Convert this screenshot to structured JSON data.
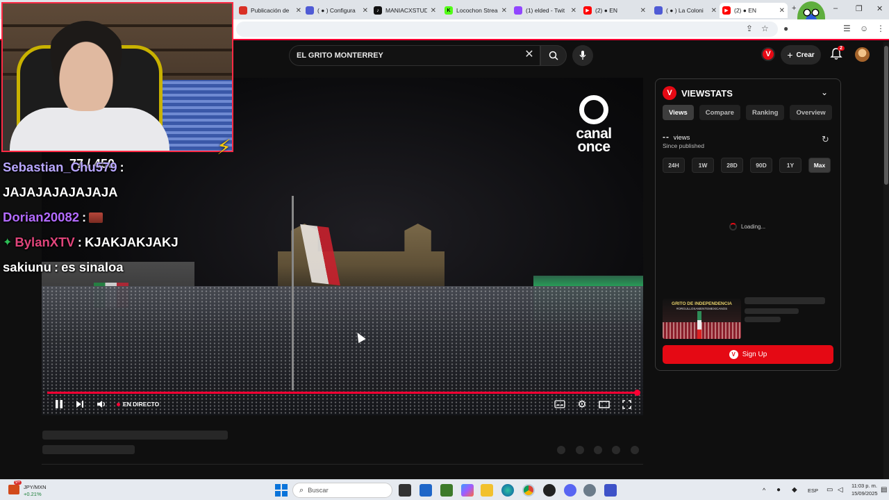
{
  "browser": {
    "tabs": [
      {
        "title": "Publicación de",
        "favicon_color": "#d93025",
        "icon": "page-icon"
      },
      {
        "title": "( ● ) Configura",
        "favicon_color": "#4f5bd5",
        "icon": "studio-icon"
      },
      {
        "title": "MANIACXSTUD",
        "favicon_color": "#111111",
        "icon": "tiktok-icon"
      },
      {
        "title": "Locochon Strea",
        "favicon_color": "#53fc18",
        "icon": "kick-icon"
      },
      {
        "title": "(1) elded - Twit",
        "favicon_color": "#9146ff",
        "icon": "twitch-icon"
      },
      {
        "title": "(2) ● EN",
        "favicon_color": "#ff0000",
        "icon": "youtube-icon"
      },
      {
        "title": "( ● ) La Coloni",
        "favicon_color": "#4f5bd5",
        "icon": "studio-icon"
      },
      {
        "title": "(2) ● EN",
        "favicon_color": "#ff0000",
        "icon": "youtube-icon"
      }
    ],
    "new_tab": "+",
    "window_controls": [
      "–",
      "❐",
      "✕"
    ]
  },
  "youtube": {
    "search_value": "EL GRITO MONTERREY",
    "create_label": "Crear",
    "notification_count": "2",
    "live_label": "EN DIRECTO"
  },
  "video": {
    "channel_logo_text": "canal\nonce"
  },
  "stream_overlay": {
    "counter": "77 / 450",
    "chat": [
      {
        "user": "Sebastian_Chu579",
        "user_color": "#b9a7ff",
        "message": "",
        "badge": ""
      },
      {
        "user": "",
        "user_color": "#ffffff",
        "message": "JAJAJAJAJAJAJA",
        "badge": ""
      },
      {
        "user": "Dorian20082",
        "user_color": "#b36bff",
        "message": "",
        "badge": "emote"
      },
      {
        "user": "BylanXTV",
        "user_color": "#e0457b",
        "message": "KJAKJAKJAKJ",
        "badge": "diamond"
      },
      {
        "user": "sakiunu",
        "user_color": "#ffffff",
        "message": "es sinaloa",
        "badge": ""
      }
    ]
  },
  "viewstats": {
    "title": "VIEWSTATS",
    "tabs": [
      "Views",
      "Compare",
      "Ranking",
      "Overview"
    ],
    "selected_tab": "Views",
    "views_value": "--",
    "views_label": "views",
    "since_label": "Since published",
    "ranges": [
      "24H",
      "1W",
      "28D",
      "90D",
      "1Y",
      "Max"
    ],
    "selected_range": "Max",
    "loading_label": "Loading...",
    "thumb_title": "GRITO DE INDEPENDENCIA",
    "thumb_subtitle": "#ORGULLOSAMENTEMEXICANOS",
    "signup_label": "Sign Up"
  },
  "taskbar": {
    "ticker_label": "JPY/MXN",
    "ticker_change": "+0.21%",
    "ticker_badge": "9+",
    "search_placeholder": "Buscar",
    "language": "ESP",
    "time": "11:03 p. m.",
    "date": "15/09/2025"
  },
  "colors": {
    "accent_red": "#ff0033",
    "viewstats_red": "#e50914",
    "bg": "#0f0f0f"
  }
}
